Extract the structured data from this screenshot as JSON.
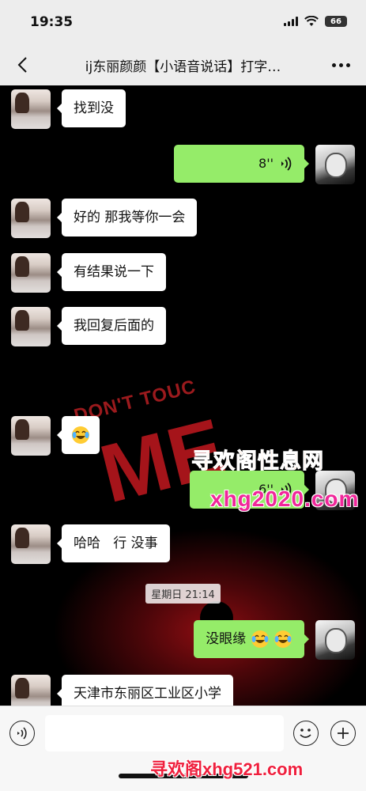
{
  "status_bar": {
    "time": "19:35",
    "battery": "66"
  },
  "nav": {
    "title": "ij东丽颜颜【小语音说话】打字…"
  },
  "messages": [
    {
      "side": "left",
      "type": "text",
      "text": "找到没"
    },
    {
      "side": "right",
      "type": "voice",
      "duration": "8''"
    },
    {
      "side": "left",
      "type": "text",
      "text": "好的 那我等你一会"
    },
    {
      "side": "left",
      "type": "text",
      "text": "有结果说一下"
    },
    {
      "side": "left",
      "type": "text",
      "text": "我回复后面的"
    },
    {
      "side": "left",
      "type": "emoji",
      "emoji": "crying-laughing"
    },
    {
      "side": "right",
      "type": "voice",
      "duration": "6''"
    },
    {
      "side": "left",
      "type": "text",
      "text": "哈哈   行 没事"
    },
    {
      "side": "right",
      "type": "text_emoji",
      "text": "没眼缘",
      "emoji": [
        "crying-laughing",
        "crying-laughing"
      ]
    },
    {
      "side": "left",
      "type": "text",
      "text": "天津市东丽区工业区小学"
    }
  ],
  "time_divider": "星期日 21:14",
  "background_art": {
    "text_small": "DON'T TOUC",
    "text_large": "ME"
  },
  "watermarks": {
    "top": "寻欢阁性息网",
    "url": "xhg2020.com",
    "bottom": "寻欢阁xhg521.com"
  },
  "colors": {
    "bubble_self": "#95ec69",
    "bubble_other": "#ffffff",
    "chat_bg": "#000000",
    "bars": "#ededed"
  }
}
